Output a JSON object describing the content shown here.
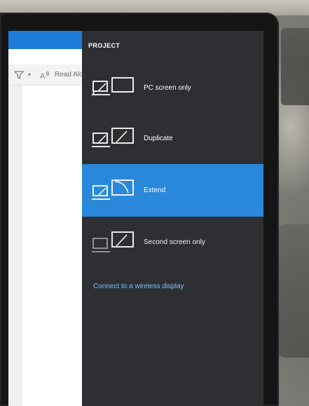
{
  "panel": {
    "title": "PROJECT",
    "options": [
      {
        "label": "PC screen only",
        "icon": "pc-screen-only-icon",
        "selected": false
      },
      {
        "label": "Duplicate",
        "icon": "duplicate-icon",
        "selected": false
      },
      {
        "label": "Extend",
        "icon": "extend-icon",
        "selected": true
      },
      {
        "label": "Second screen only",
        "icon": "second-screen-only-icon",
        "selected": false
      }
    ],
    "connect_label": "Connect to a wireless display"
  },
  "app": {
    "read_aloud_label": "Read Alo"
  },
  "colors": {
    "panel_background": "#2d2f33",
    "selected_background": "#2a88db",
    "link": "#79c3ff",
    "window_accent": "#1e7cd8"
  }
}
